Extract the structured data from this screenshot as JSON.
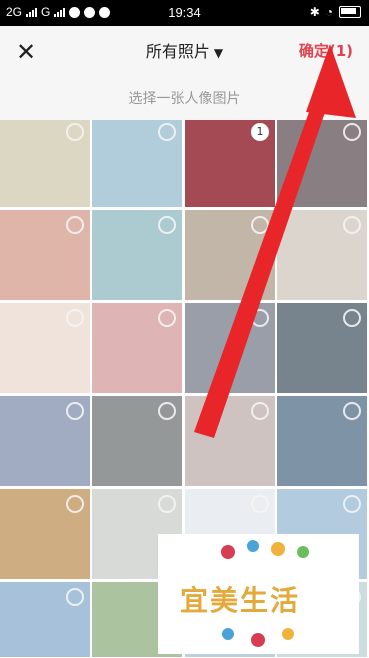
{
  "status_bar": {
    "left": "2G",
    "left2": "G",
    "time": "19:34"
  },
  "header": {
    "title": "所有照片",
    "confirm_label": "确定(1)",
    "subtitle": "选择一张人像图片"
  },
  "grid": {
    "selected_badge": "1",
    "row_colors": [
      [
        "#c9c2a1",
        "#87b1c8",
        "#a44a55",
        "#4a3a3e"
      ],
      [
        "#cc8e7a",
        "#7fb0b9",
        "#a08f78",
        "#c9bfb2"
      ],
      [
        "#e9d5c8",
        "#cd8c8c",
        "#636b7a",
        "#2f4250"
      ],
      [
        "#6f80a4",
        "#5d6263",
        "#b4a4a0",
        "#3b5a79"
      ],
      [
        "#b2823e",
        "#c4c6c2",
        "#dfe4ea",
        "#8ab0cc"
      ],
      [
        "#7aa0c6",
        "#7ea36a",
        "#9ab7c9",
        "#b3c9d1"
      ]
    ]
  },
  "watermark": {
    "text": "宜美生活"
  },
  "colors": {
    "confirm": "#e0434f",
    "arrow": "#e8262a"
  }
}
